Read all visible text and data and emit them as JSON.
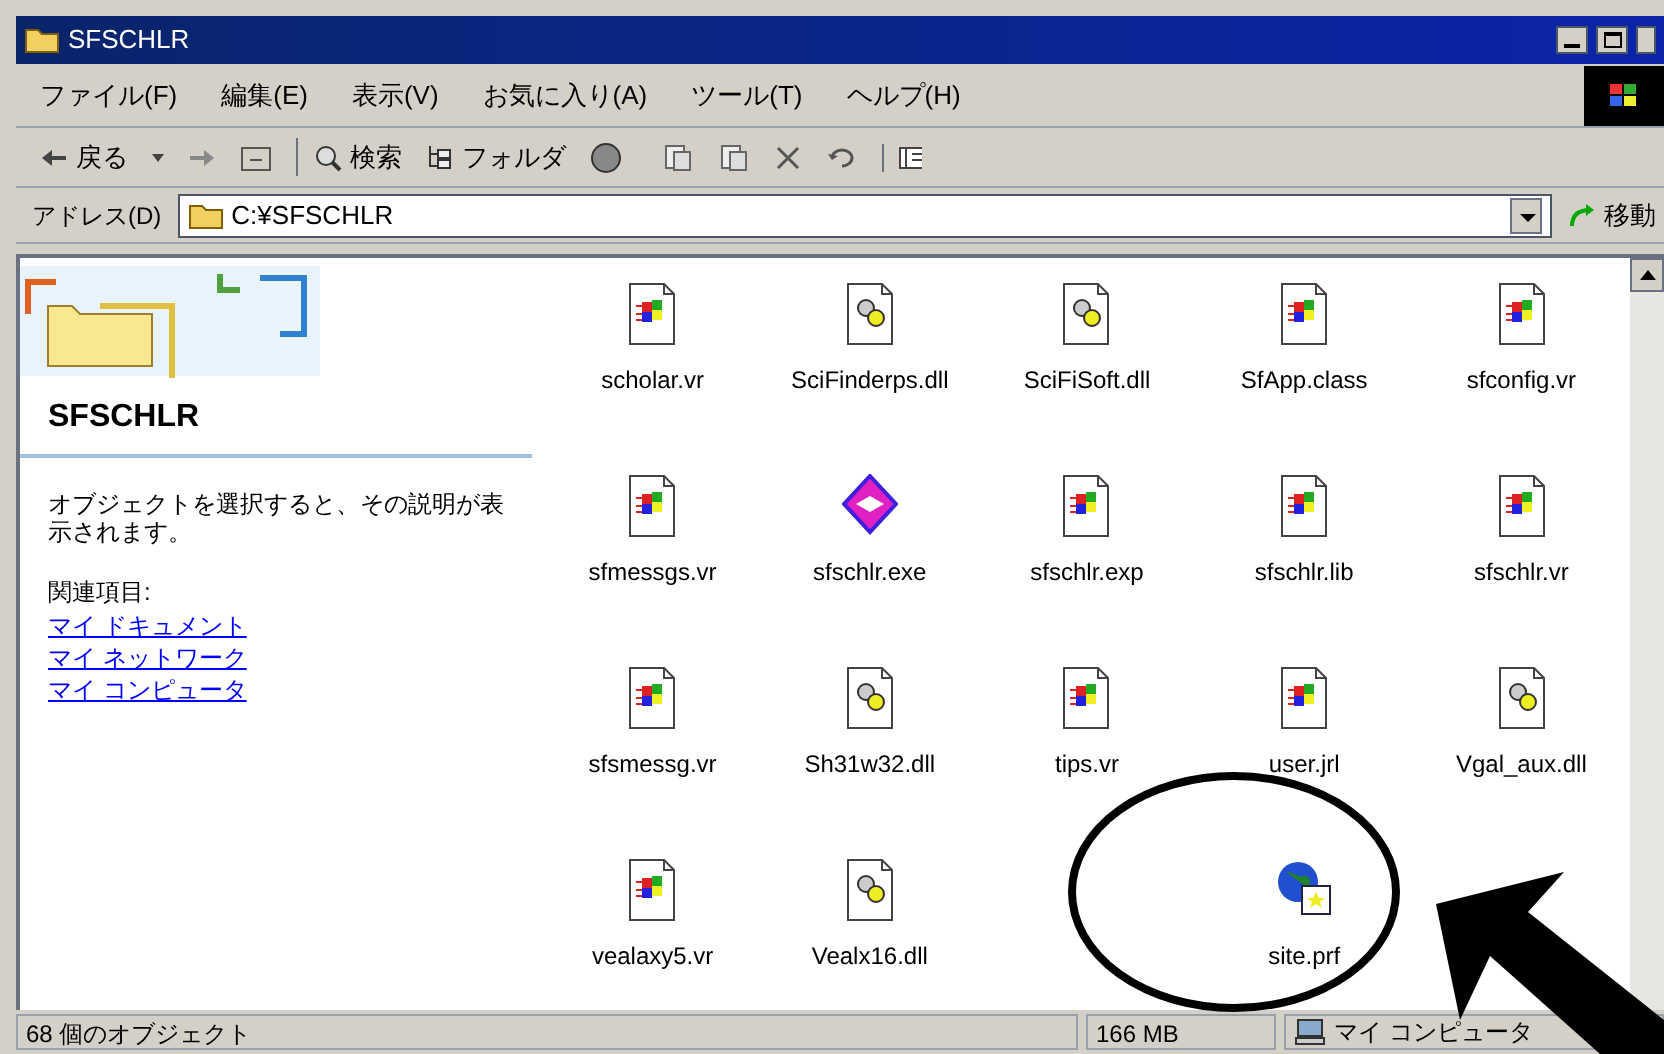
{
  "window": {
    "title": "SFSCHLR"
  },
  "menu": [
    "ファイル(F)",
    "編集(E)",
    "表示(V)",
    "お気に入り(A)",
    "ツール(T)",
    "ヘルプ(H)"
  ],
  "toolbar": {
    "back": "戻る",
    "search": "検索",
    "folders": "フォルダ"
  },
  "address": {
    "label": "アドレス(D)",
    "value": "C:¥SFSCHLR",
    "go": "移動"
  },
  "sidebar": {
    "title": "SFSCHLR",
    "description": "オブジェクトを選択すると、その説明が表示されます。",
    "related_label": "関連項目:",
    "links": [
      "マイ ドキュメント",
      "マイ ネットワーク",
      "マイ コンピュータ"
    ]
  },
  "files": [
    [
      {
        "name": "scholar.vr",
        "kind": "vr"
      },
      {
        "name": "SciFinderps.dll",
        "kind": "dll"
      },
      {
        "name": "SciFiSoft.dll",
        "kind": "dll"
      },
      {
        "name": "SfApp.class",
        "kind": "vr"
      },
      {
        "name": "sfconfig.vr",
        "kind": "vr"
      }
    ],
    [
      {
        "name": "sfmessgs.vr",
        "kind": "vr"
      },
      {
        "name": "sfschlr.exe",
        "kind": "exe"
      },
      {
        "name": "sfschlr.exp",
        "kind": "vr"
      },
      {
        "name": "sfschlr.lib",
        "kind": "vr"
      },
      {
        "name": "sfschlr.vr",
        "kind": "vr"
      }
    ],
    [
      {
        "name": "sfsmessg.vr",
        "kind": "vr"
      },
      {
        "name": "Sh31w32.dll",
        "kind": "dll"
      },
      {
        "name": "tips.vr",
        "kind": "vr"
      },
      {
        "name": "user.jrl",
        "kind": "vr"
      },
      {
        "name": "Vgal_aux.dll",
        "kind": "dll"
      }
    ],
    [
      {
        "name": "vealaxy5.vr",
        "kind": "vr"
      },
      {
        "name": "Vealx16.dll",
        "kind": "dll"
      },
      {
        "kind": "none"
      },
      {
        "name": "site.prf",
        "kind": "prf"
      },
      {
        "kind": "none"
      }
    ]
  ],
  "status_bar": {
    "count": "68 個のオブジェクト",
    "size": "166 MB",
    "zone": "マイ コンピュータ"
  }
}
